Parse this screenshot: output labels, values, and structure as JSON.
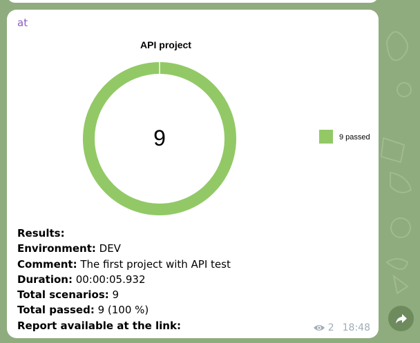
{
  "message": {
    "sender": "at",
    "views": "2",
    "time": "18:48"
  },
  "chart_data": {
    "type": "pie",
    "title": "API project",
    "center_label": "9",
    "categories": [
      "9 passed"
    ],
    "values": [
      9
    ],
    "colors": [
      "#92c966"
    ],
    "legend_placement": "right"
  },
  "results": {
    "heading": "Results:",
    "environment_label": "Environment:",
    "environment_value": " DEV",
    "comment_label": "Comment:",
    "comment_value": " The first project with API test",
    "duration_label": "Duration:",
    "duration_value": " 00:00:05.932",
    "scenarios_label": "Total scenarios:",
    "scenarios_value": " 9",
    "passed_label": "Total passed:",
    "passed_value": " 9 (100 %)",
    "report_label": "Report available at the link:"
  },
  "colors": {
    "background": "#8fac7e",
    "sender": "#8a5cc7",
    "meta": "#a0acb6",
    "share_button": "#6d8b5d"
  },
  "icons": {
    "views": "eye-icon",
    "share": "share-arrow-icon"
  }
}
